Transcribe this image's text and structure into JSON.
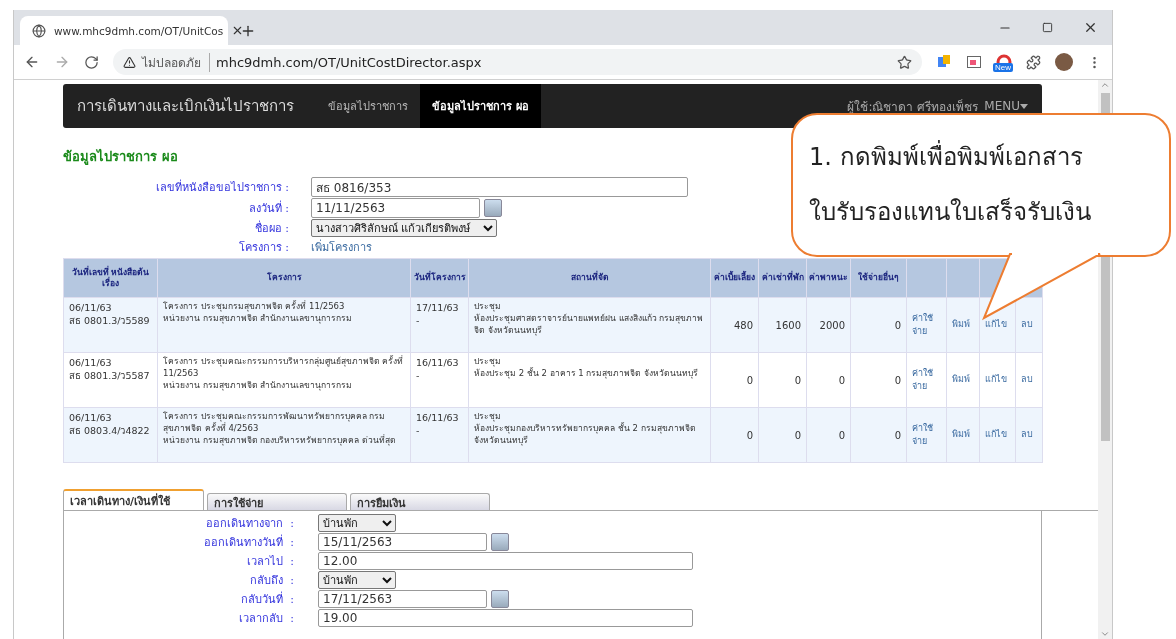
{
  "browser": {
    "tab_title": "www.mhc9dmh.com/OT/UnitCos",
    "security": "ไม่ปลอดภัย",
    "url": "mhc9dmh.com/OT/UnitCostDirector.aspx",
    "extension_badge": "New"
  },
  "navbar": {
    "brand": "การเดินทางและเบิกเงินไปราชการ",
    "items": [
      {
        "label": "ข้อมูลไปราชการ",
        "selected": false
      },
      {
        "label": "ข้อมูลไปราชการ ผอ",
        "selected": true
      }
    ],
    "user": "ผู้ใช้:ณิชาดา ศรีทองเพ็ชร",
    "menu": "MENU"
  },
  "page_title": "ข้อมูลไปราชการ ผอ",
  "form": [
    {
      "label": "เลขที่หนังสือขอไปราชการ :",
      "kind": "text",
      "value": "สธ 0816/353"
    },
    {
      "label": "ลงวันที่ :",
      "kind": "date",
      "value": "11/11/2563"
    },
    {
      "label": "ชื่อผอ :",
      "kind": "select",
      "value": "นางสาวศิริลักษณ์ แก้วเกียรติพงษ์"
    },
    {
      "label": "โครงการ :",
      "kind": "link",
      "value": "เพิ่มโครงการ"
    }
  ],
  "table": {
    "columns": [
      "วันที่เลขที่ หนังสือต้นเรื่อง",
      "โครงการ",
      "วันที่โครงการ",
      "สถานที่จัด",
      "ค่าเบี้ยเลี้ยง",
      "ค่าเช่าที่พัก",
      "ค่าพาหนะ",
      "ใช้จ่ายอื่นๆ"
    ],
    "rows": [
      {
        "doc": [
          "06/11/63",
          "สธ 0801.3/ว5589"
        ],
        "project": [
          "โครงการ ประชุมกรมสุขภาพจิต ครั้งที่ 11/2563",
          "หน่วยงาน กรมสุขภาพจิต สำนักงานเลขานุการกรม"
        ],
        "date": [
          "17/11/63",
          "-"
        ],
        "venue": [
          "ประชุม",
          "ห้องประชุมศาสตราจารย์นายแพทย์ฝน แสงสิงแก้ว กรมสุขภาพจิต จังหวัดนนทบุรี"
        ],
        "amounts": [
          "480",
          "1600",
          "2000",
          "0"
        ],
        "actions": [
          "ค่าใช้จ่าย",
          "พิมพ์",
          "แก้ไข",
          "ลบ"
        ]
      },
      {
        "doc": [
          "06/11/63",
          "สธ 0801.3/ว5587"
        ],
        "project": [
          "โครงการ ประชุมคณะกรรมการบริหารกลุ่มศูนย์สุขภาพจิต ครั้งที่ 11/2563",
          "หน่วยงาน กรมสุขภาพจิต สำนักงานเลขานุการกรม"
        ],
        "date": [
          "16/11/63",
          "-"
        ],
        "venue": [
          "ประชุม",
          "ห้องประชุม 2 ชั้น 2 อาคาร 1 กรมสุขภาพจิต จังหวัดนนทบุรี"
        ],
        "amounts": [
          "0",
          "0",
          "0",
          "0"
        ],
        "actions": [
          "ค่าใช้จ่าย",
          "พิมพ์",
          "แก้ไข",
          "ลบ"
        ]
      },
      {
        "doc": [
          "06/11/63",
          "สธ 0803.4/ว4822"
        ],
        "project": [
          "โครงการ ประชุมคณะกรรมการพัฒนาทรัพยากรบุคคล กรมสุขภาพจิต ครั้งที่ 4/2563",
          "หน่วยงาน กรมสุขภาพจิต กองบริหารทรัพยากรบุคคล ด่วนที่สุด"
        ],
        "date": [
          "16/11/63",
          "-"
        ],
        "venue": [
          "ประชุม",
          "ห้องประชุมกองบริหารทรัพยากรบุคคล ชั้น 2 กรมสุขภาพจิต จังหวัดนนทบุรี"
        ],
        "amounts": [
          "0",
          "0",
          "0",
          "0"
        ],
        "actions": [
          "ค่าใช้จ่าย",
          "พิมพ์",
          "แก้ไข",
          "ลบ"
        ]
      }
    ]
  },
  "tabs": [
    {
      "label": "เวลาเดินทาง/เงินที่ใช้",
      "selected": true
    },
    {
      "label": "การใช้จ่าย",
      "selected": false
    },
    {
      "label": "การยืมเงิน",
      "selected": false
    }
  ],
  "travel_form": [
    {
      "label": "ออกเดินทางจาก  :",
      "kind": "select",
      "value": "บ้านพัก"
    },
    {
      "label": "ออกเดินทางวันที่  :",
      "kind": "date",
      "value": "15/11/2563"
    },
    {
      "label": "เวลาไป  :",
      "kind": "text",
      "value": "12.00"
    },
    {
      "label": "กลับถึง  :",
      "kind": "select",
      "value": "บ้านพัก"
    },
    {
      "label": "กลับวันที่  :",
      "kind": "date",
      "value": "17/11/2563"
    },
    {
      "label": "เวลากลับ  :",
      "kind": "text",
      "value": "19.00"
    }
  ],
  "callout": {
    "lines": [
      "1. กดพิมพ์เพื่อพิมพ์เอกสาร",
      "ใบรับรองแทนใบเสร็จรับเงิน"
    ]
  }
}
